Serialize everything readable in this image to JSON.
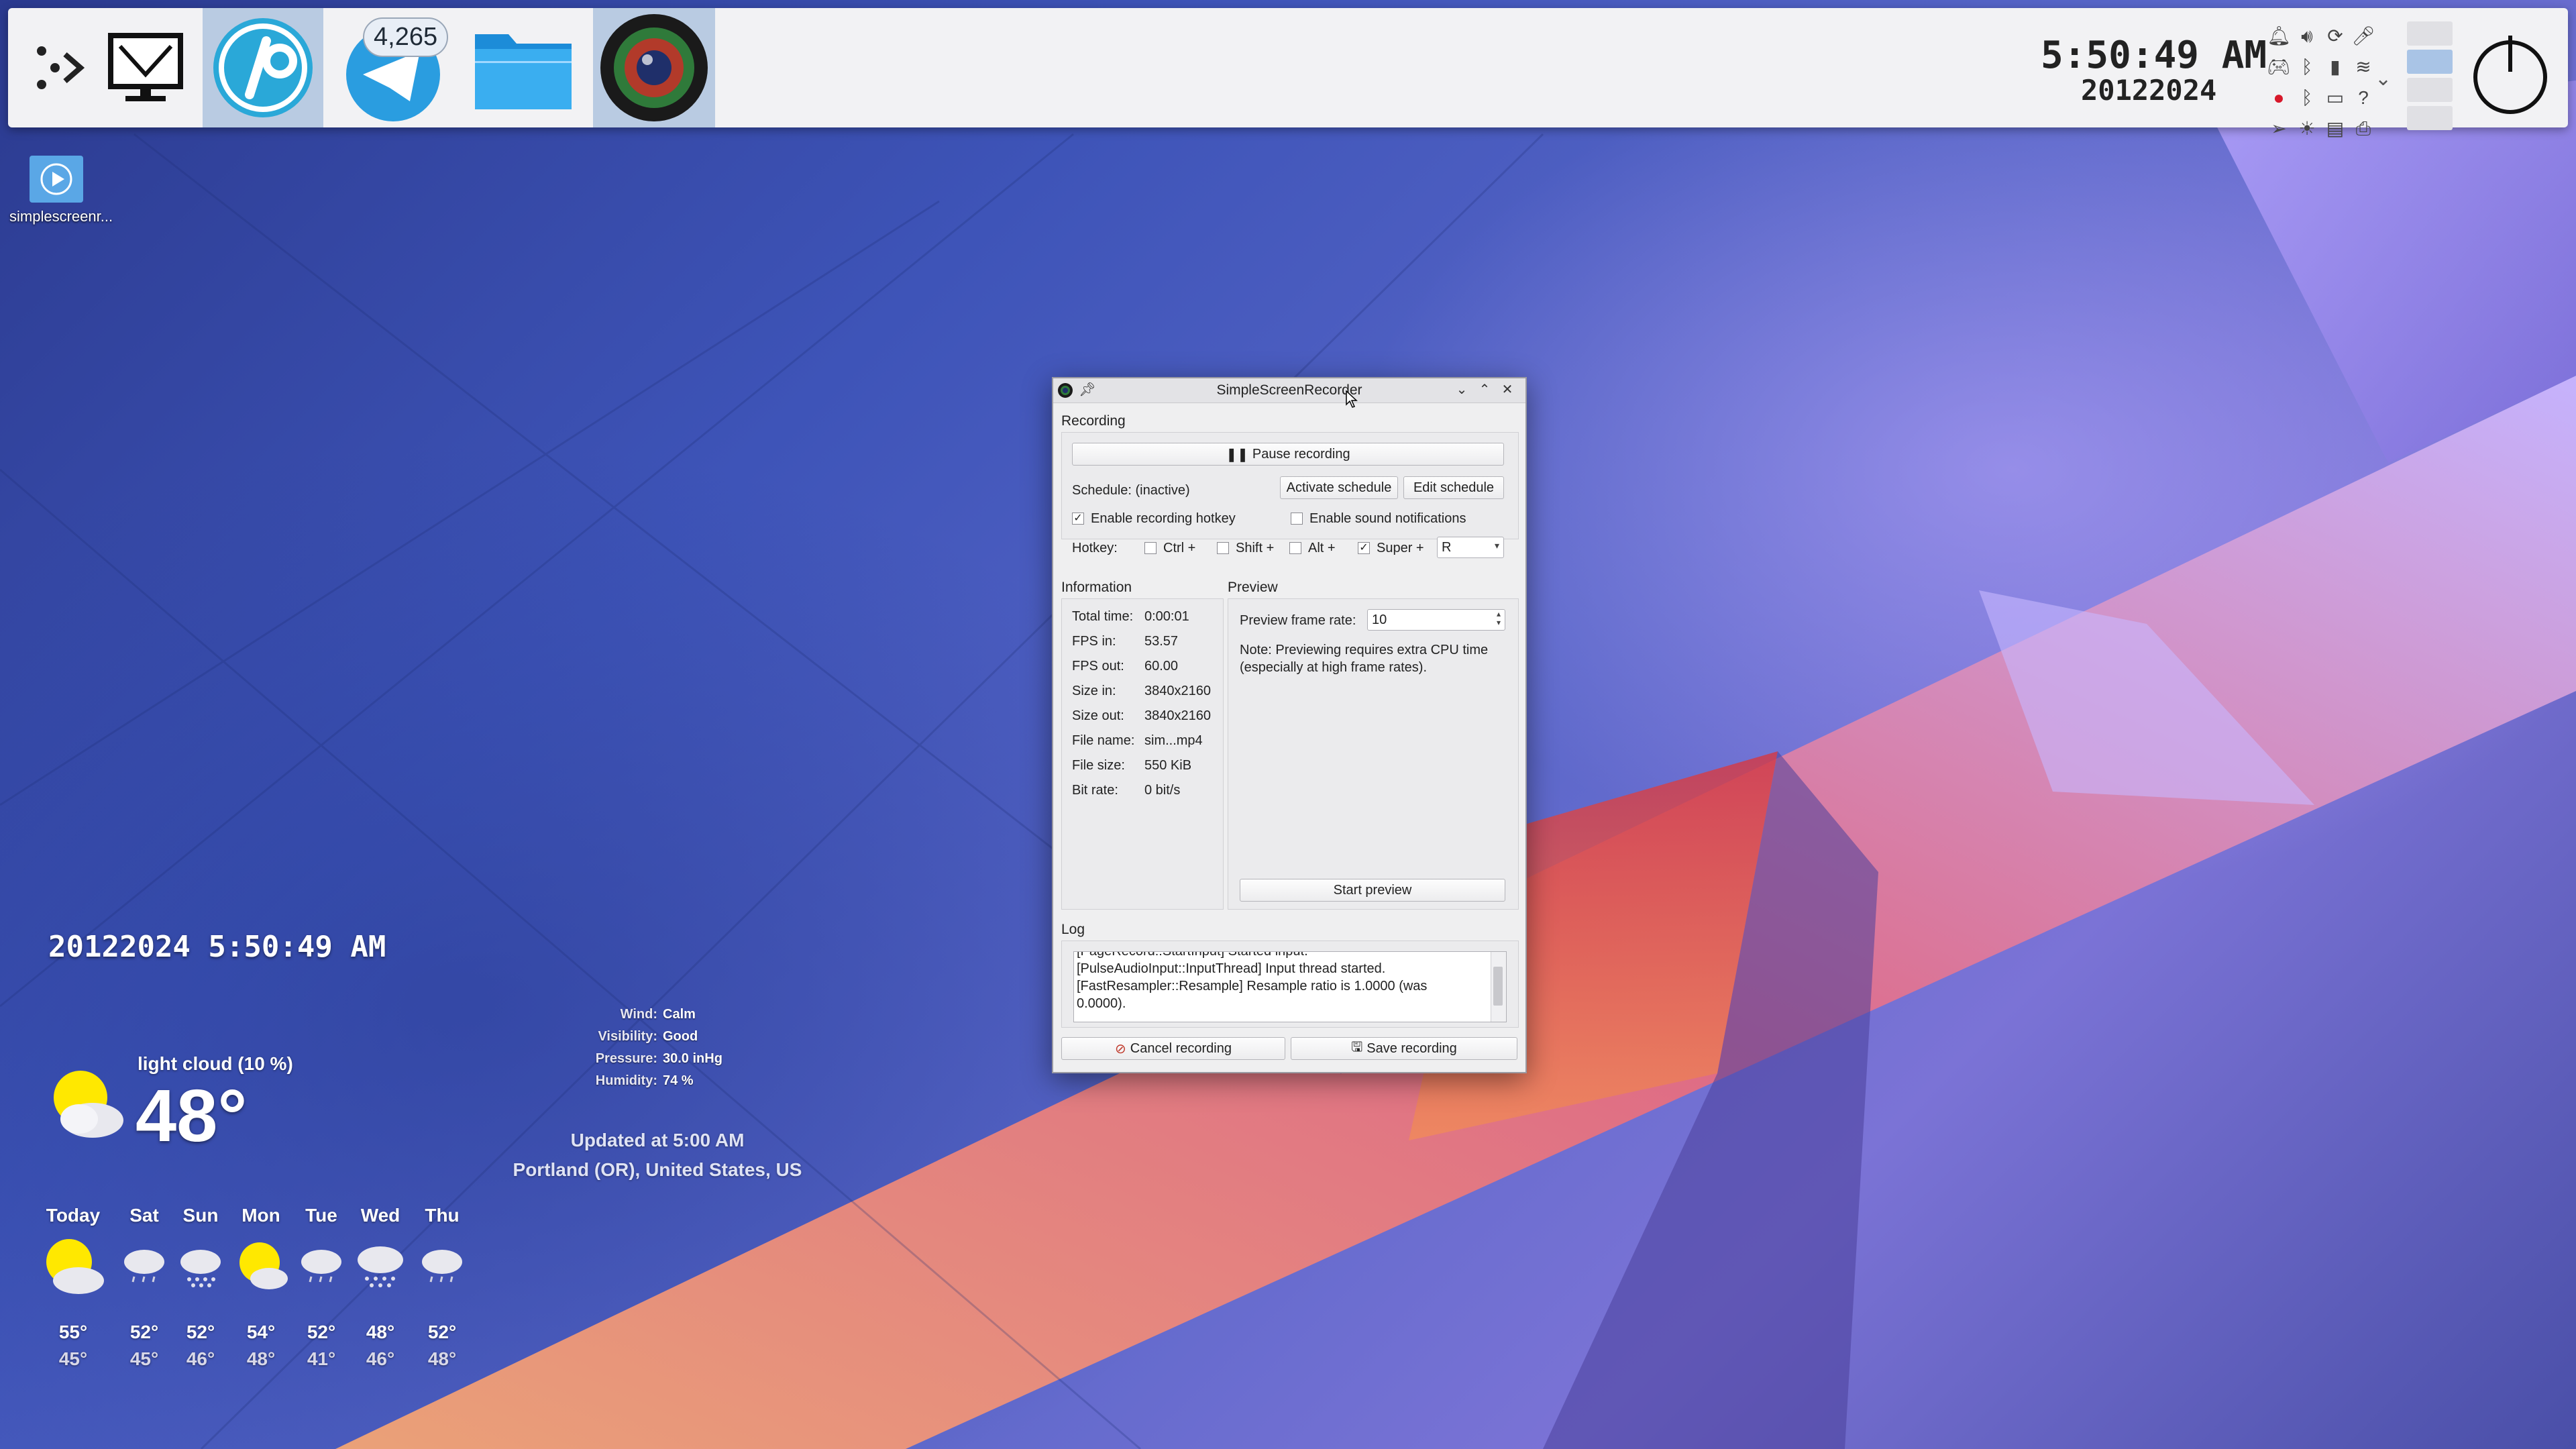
{
  "taskbar": {
    "telegram_badge": "4,265",
    "clock_time": "5:50:49 AM",
    "clock_date": "20122024",
    "icons": [
      "kickoff-dots-icon",
      "monitor-icon",
      "inkscape-app-icon",
      "telegram-app-icon",
      "file-manager-icon",
      "camera-lens-app-icon",
      "power-icon"
    ]
  },
  "desktop": {
    "file_label": "simplescreenr..."
  },
  "weather": {
    "datetime": "20122024  5:50:49 AM",
    "condition": "light cloud (10 %)",
    "temperature": "48°",
    "details": [
      {
        "key": "Wind:",
        "value": "Calm"
      },
      {
        "key": "Visibility:",
        "value": "Good"
      },
      {
        "key": "Pressure:",
        "value": "30.0 inHg"
      },
      {
        "key": "Humidity:",
        "value": "74 %"
      }
    ],
    "updated": "Updated at 5:00 AM",
    "location": "Portland (OR), United States, US",
    "forecast": [
      {
        "day": "Today",
        "hi": "55°",
        "lo": "45°",
        "icon": "sun-cloud-icon"
      },
      {
        "day": "Sat",
        "hi": "52°",
        "lo": "45°",
        "icon": "cloud-rain-icon"
      },
      {
        "day": "Sun",
        "hi": "52°",
        "lo": "46°",
        "icon": "cloud-snow-icon"
      },
      {
        "day": "Mon",
        "hi": "54°",
        "lo": "48°",
        "icon": "sun-cloud-icon"
      },
      {
        "day": "Tue",
        "hi": "52°",
        "lo": "41°",
        "icon": "cloud-rain-icon"
      },
      {
        "day": "Wed",
        "hi": "48°",
        "lo": "46°",
        "icon": "cloud-snow-icon"
      },
      {
        "day": "Thu",
        "hi": "52°",
        "lo": "48°",
        "icon": "cloud-rain-icon"
      }
    ]
  },
  "ssr": {
    "title": "SimpleScreenRecorder",
    "recording_label": "Recording",
    "pause_button": "Pause recording",
    "schedule_status": "Schedule: (inactive)",
    "activate_schedule": "Activate schedule",
    "edit_schedule": "Edit schedule",
    "enable_hotkey": "Enable recording hotkey",
    "enable_sound": "Enable sound notifications",
    "hotkey_label": "Hotkey:",
    "ctrl": "Ctrl +",
    "shift": "Shift +",
    "alt": "Alt +",
    "super": "Super +",
    "hotkey_key": "R",
    "information_label": "Information",
    "preview_label": "Preview",
    "info": [
      {
        "key": "Total time:",
        "value": "0:00:01"
      },
      {
        "key": "FPS in:",
        "value": "53.57"
      },
      {
        "key": "FPS out:",
        "value": "60.00"
      },
      {
        "key": "Size in:",
        "value": "3840x2160"
      },
      {
        "key": "Size out:",
        "value": "3840x2160"
      },
      {
        "key": "File name:",
        "value": "sim...mp4"
      },
      {
        "key": "File size:",
        "value": "550 KiB"
      },
      {
        "key": "Bit rate:",
        "value": "0 bit/s"
      }
    ],
    "preview_rate_label": "Preview frame rate:",
    "preview_rate_value": "10",
    "preview_note": "Note: Previewing requires extra CPU time (especially at high frame rates).",
    "start_preview": "Start preview",
    "log_label": "Log",
    "log_lines": [
      "[PageRecord::StartInput] Started input.",
      "[PulseAudioInput::InputThread] Input thread started.",
      "[FastResampler::Resample] Resample ratio is 1.0000 (was 0.0000)."
    ],
    "cancel_recording": "Cancel recording",
    "save_recording": "Save recording"
  }
}
